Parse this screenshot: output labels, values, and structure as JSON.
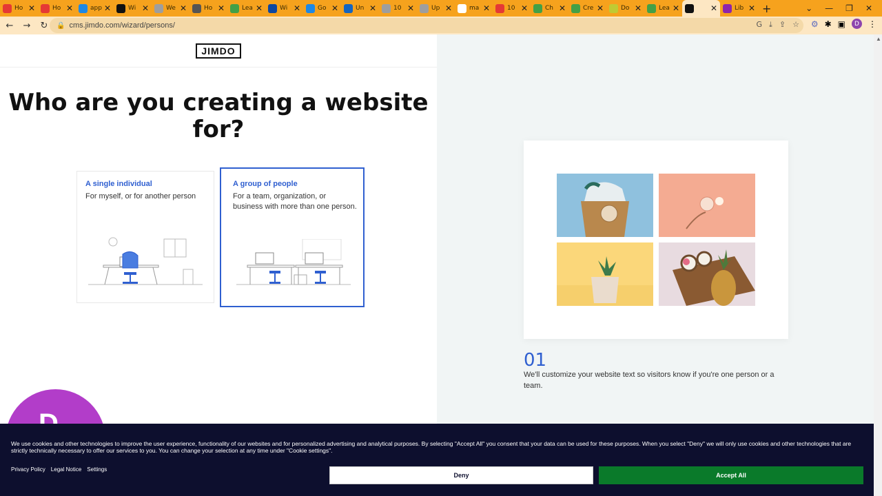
{
  "browser": {
    "tabs": [
      {
        "label": "Ho",
        "color": "#e53935"
      },
      {
        "label": "Ho",
        "color": "#e53935"
      },
      {
        "label": "app",
        "color": "#1e88e5"
      },
      {
        "label": "Wi",
        "color": "#111111"
      },
      {
        "label": "We",
        "color": "#9e9e9e"
      },
      {
        "label": "Ho",
        "color": "#555555"
      },
      {
        "label": "Lea",
        "color": "#43a047"
      },
      {
        "label": "Wi",
        "color": "#0d47a1"
      },
      {
        "label": "Go",
        "color": "#1e88e5"
      },
      {
        "label": "Un",
        "color": "#1565c0"
      },
      {
        "label": "10",
        "color": "#9e9e9e"
      },
      {
        "label": "Up",
        "color": "#9e9e9e"
      },
      {
        "label": "ma",
        "color": "#ffffff"
      },
      {
        "label": "10",
        "color": "#e53935"
      },
      {
        "label": "Ch",
        "color": "#43a047"
      },
      {
        "label": "Cre",
        "color": "#43a047"
      },
      {
        "label": "Do",
        "color": "#c0ca33"
      },
      {
        "label": "Lea",
        "color": "#43a047"
      },
      {
        "label": "",
        "color": "#111111",
        "active": true
      },
      {
        "label": "Lib",
        "color": "#8e24aa"
      }
    ],
    "url": "cms.jimdo.com/wizard/persons/",
    "profile_initial": "D",
    "accent": "#f6a21d"
  },
  "page": {
    "logo": "JIMDO",
    "title": "Who are you creating a website for?",
    "cards": [
      {
        "title": "A single individual",
        "desc": "For myself, or for another person"
      },
      {
        "title": "A group of people",
        "desc": "For a team, organization, or business with more than one person."
      }
    ],
    "avatar_letter": "D",
    "step_number": "01",
    "step_text": "We'll customize your website text so visitors know if you're one person or a team.",
    "accent_blue": "#2f5fd0"
  },
  "cookie": {
    "message": "We use cookies and other technologies to improve the user experience, functionality of our websites and for personalized advertising and analytical purposes. By selecting \"Accept All\" you consent that your data can be used for these purposes. When you select \"Deny\" we will only use cookies and other technologies that are strictly technically necessary to offer our services to you. You can change your selection at any time under \"Cookie settings\".",
    "links": [
      "Privacy Policy",
      "Legal Notice",
      "Settings"
    ],
    "deny_label": "Deny",
    "accept_label": "Accept All"
  }
}
